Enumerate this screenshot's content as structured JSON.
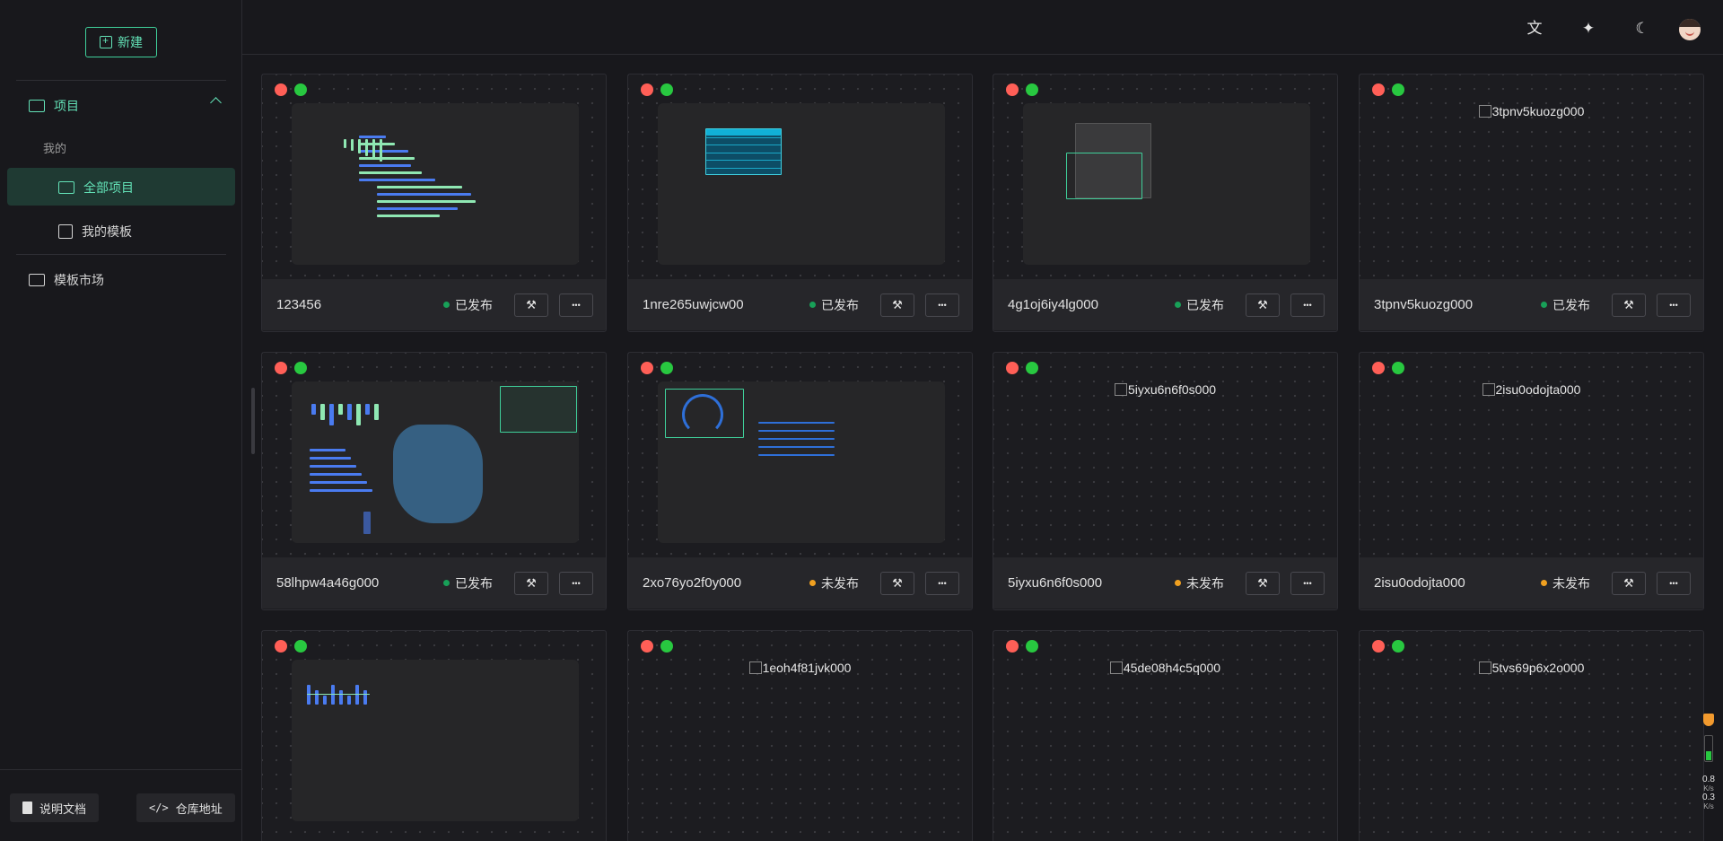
{
  "sidebar": {
    "new_label": "新建",
    "project_label": "项目",
    "mine_label": "我的",
    "all_projects_label": "全部项目",
    "my_templates_label": "我的模板",
    "market_label": "模板市场",
    "docs_label": "说明文档",
    "repo_label": "仓库地址"
  },
  "header": {
    "icons": [
      "translate-icon",
      "magic-wand-icon",
      "moon-icon",
      "avatar"
    ]
  },
  "status_colors": {
    "published": "#18a058",
    "unpublished": "#f0a020"
  },
  "cards": [
    {
      "name": "123456",
      "status": "已发布",
      "state": "published",
      "preview": "bar-chart"
    },
    {
      "name": "1nre265uwjcw00",
      "status": "已发布",
      "state": "published",
      "preview": "table"
    },
    {
      "name": "4g1oj6iy4lg000",
      "status": "已发布",
      "state": "published",
      "preview": "map"
    },
    {
      "name": "3tpnv5kuozg000",
      "status": "已发布",
      "state": "published",
      "preview": "broken",
      "alt": "3tpnv5kuozg000"
    },
    {
      "name": "58lhpw4a46g000",
      "status": "已发布",
      "state": "published",
      "preview": "dashboard"
    },
    {
      "name": "2xo76yo2f0y000",
      "status": "未发布",
      "state": "unpublished",
      "preview": "gauge"
    },
    {
      "name": "5iyxu6n6f0s000",
      "status": "未发布",
      "state": "unpublished",
      "preview": "broken",
      "alt": "5iyxu6n6f0s000"
    },
    {
      "name": "2isu0odojta000",
      "status": "未发布",
      "state": "unpublished",
      "preview": "broken",
      "alt": "2isu0odojta000"
    },
    {
      "name": "",
      "status": "",
      "state": "",
      "preview": "line-bar"
    },
    {
      "name": "",
      "status": "",
      "state": "",
      "preview": "broken",
      "alt": "1eoh4f81jvk000"
    },
    {
      "name": "",
      "status": "",
      "state": "",
      "preview": "broken",
      "alt": "45de08h4c5q000"
    },
    {
      "name": "",
      "status": "",
      "state": "",
      "preview": "broken",
      "alt": "5tvs69p6x2o000"
    }
  ],
  "net_widget": {
    "up": "0.8",
    "down": "0.3",
    "unit": "K/s"
  }
}
